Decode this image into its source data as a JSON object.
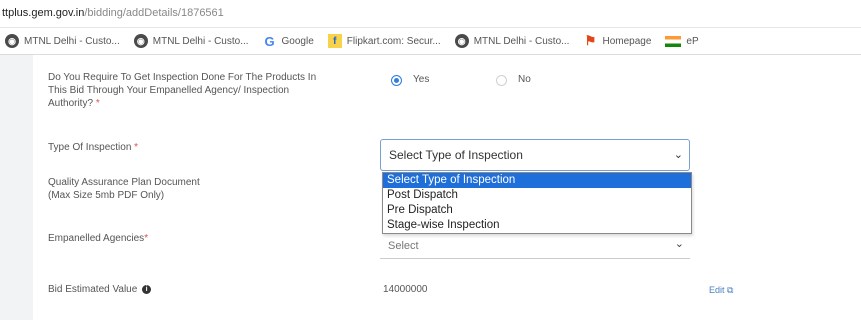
{
  "address_bar": {
    "host": "ttplus.gem.gov.in",
    "path": "/bidding/addDetails/1876561"
  },
  "bookmarks": [
    {
      "icon": "globe-icon",
      "label": "MTNL Delhi - Custo..."
    },
    {
      "icon": "globe-icon",
      "label": "MTNL Delhi - Custo..."
    },
    {
      "icon": "google-icon",
      "label": "Google"
    },
    {
      "icon": "flipkart-icon",
      "label": "Flipkart.com: Secur..."
    },
    {
      "icon": "globe-icon",
      "label": "MTNL Delhi - Custo..."
    },
    {
      "icon": "home-icon",
      "label": "Homepage"
    },
    {
      "icon": "india-flag-icon",
      "label": "eP"
    }
  ],
  "form": {
    "inspection_question": {
      "label": "Do You Require To Get Inspection Done For The Products In This Bid Through Your Empanelled Agency/ Inspection Authority?",
      "required_mark": "*",
      "options": [
        "Yes",
        "No"
      ],
      "selected": "Yes"
    },
    "type_of_inspection": {
      "label": "Type Of Inspection",
      "required_mark": "*",
      "value": "Select Type of Inspection",
      "dropdown_options": [
        "Select Type of Inspection",
        "Post Dispatch",
        "Pre Dispatch",
        "Stage-wise Inspection"
      ],
      "highlighted_option": "Select Type of Inspection"
    },
    "quality_assurance": {
      "label_line1": "Quality Assurance Plan Document",
      "label_line2": "(Max Size 5mb PDF Only)"
    },
    "empanelled_agencies": {
      "label": "Empanelled Agencies",
      "required_mark": "*",
      "value": "Select"
    },
    "bid_estimated_value": {
      "label": "Bid Estimated Value",
      "info_icon": "info-icon",
      "value": "14000000",
      "edit_label": "Edit",
      "edit_icon": "external-link-icon"
    }
  },
  "colors": {
    "accent": "#1e6fd9",
    "required": "#d9534f",
    "link": "#4a7fc1"
  }
}
